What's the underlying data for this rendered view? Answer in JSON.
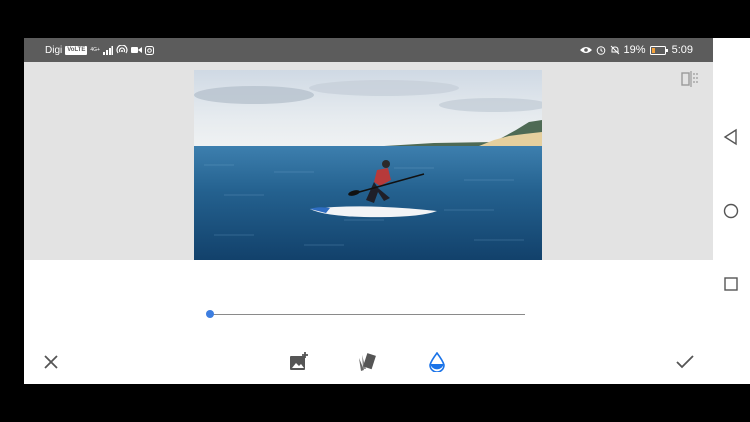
{
  "status_bar": {
    "carrier": "Digi",
    "volte": "VoLTE",
    "network": "4G+",
    "battery_percent": "19%",
    "time": "5:09"
  },
  "editor": {
    "tool": "Tonal Contrast",
    "slider_value_fraction": 0.0
  },
  "toolbar": {
    "cancel": "close-icon",
    "tools": [
      "image-add-icon",
      "style-icon",
      "tonal-contrast-icon"
    ],
    "apply": "check-icon",
    "active_tool_color": "#1a73e8"
  },
  "nav_bar": [
    "back-icon",
    "home-icon",
    "recents-icon"
  ]
}
